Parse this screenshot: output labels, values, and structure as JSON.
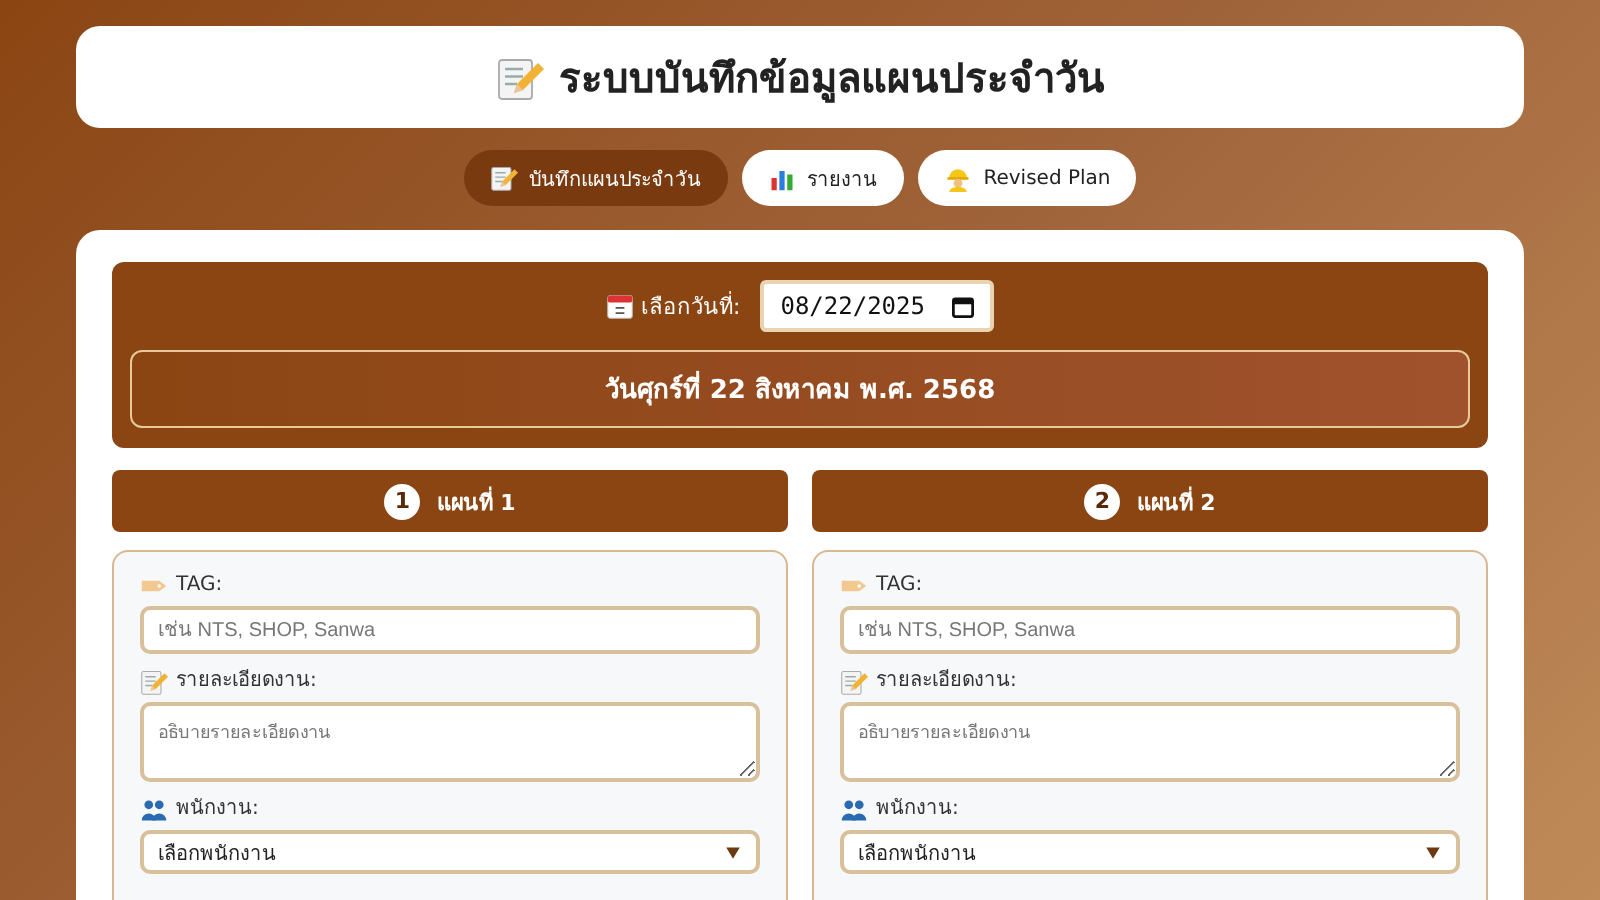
{
  "header": {
    "title": "ระบบบันทึกข้อมูลแผนประจำวัน"
  },
  "tabs": [
    {
      "label": "บันทึกแผนประจำวัน",
      "selected": true
    },
    {
      "label": "รายงาน",
      "selected": false
    },
    {
      "label": "Revised Plan",
      "selected": false
    }
  ],
  "date_picker": {
    "label": "เลือกวันที่:",
    "value": "08/22/2025"
  },
  "date_display": "วันศุกร์ที่ 22 สิงหาคม พ.ศ. 2568",
  "plans": [
    {
      "number": "1",
      "title": "แผนที่ 1",
      "fields": [
        {
          "kind": "text",
          "label": "TAG:",
          "placeholder": "เช่น NTS, SHOP, Sanwa"
        },
        {
          "kind": "textarea",
          "label": "รายละเอียดงาน:",
          "placeholder": "อธิบายรายละเอียดงาน"
        },
        {
          "kind": "select",
          "label": "พนักงาน:",
          "value": "เลือกพนักงาน"
        }
      ]
    },
    {
      "number": "2",
      "title": "แผนที่ 2",
      "fields": [
        {
          "kind": "text",
          "label": "TAG:",
          "placeholder": "เช่น NTS, SHOP, Sanwa"
        },
        {
          "kind": "textarea",
          "label": "รายละเอียดงาน:",
          "placeholder": "อธิบายรายละเอียดงาน"
        },
        {
          "kind": "select",
          "label": "พนักงาน:",
          "value": "เลือกพนักงาน"
        }
      ]
    }
  ]
}
